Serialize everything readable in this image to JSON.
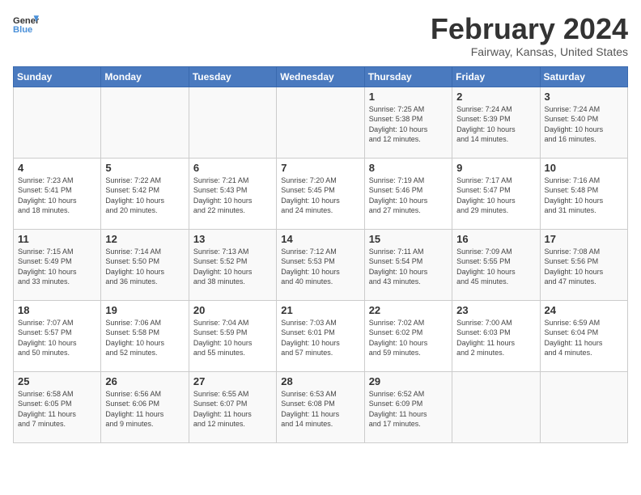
{
  "header": {
    "logo_line1": "General",
    "logo_line2": "Blue",
    "month_title": "February 2024",
    "location": "Fairway, Kansas, United States"
  },
  "days_of_week": [
    "Sunday",
    "Monday",
    "Tuesday",
    "Wednesday",
    "Thursday",
    "Friday",
    "Saturday"
  ],
  "weeks": [
    [
      {
        "num": "",
        "info": ""
      },
      {
        "num": "",
        "info": ""
      },
      {
        "num": "",
        "info": ""
      },
      {
        "num": "",
        "info": ""
      },
      {
        "num": "1",
        "info": "Sunrise: 7:25 AM\nSunset: 5:38 PM\nDaylight: 10 hours\nand 12 minutes."
      },
      {
        "num": "2",
        "info": "Sunrise: 7:24 AM\nSunset: 5:39 PM\nDaylight: 10 hours\nand 14 minutes."
      },
      {
        "num": "3",
        "info": "Sunrise: 7:24 AM\nSunset: 5:40 PM\nDaylight: 10 hours\nand 16 minutes."
      }
    ],
    [
      {
        "num": "4",
        "info": "Sunrise: 7:23 AM\nSunset: 5:41 PM\nDaylight: 10 hours\nand 18 minutes."
      },
      {
        "num": "5",
        "info": "Sunrise: 7:22 AM\nSunset: 5:42 PM\nDaylight: 10 hours\nand 20 minutes."
      },
      {
        "num": "6",
        "info": "Sunrise: 7:21 AM\nSunset: 5:43 PM\nDaylight: 10 hours\nand 22 minutes."
      },
      {
        "num": "7",
        "info": "Sunrise: 7:20 AM\nSunset: 5:45 PM\nDaylight: 10 hours\nand 24 minutes."
      },
      {
        "num": "8",
        "info": "Sunrise: 7:19 AM\nSunset: 5:46 PM\nDaylight: 10 hours\nand 27 minutes."
      },
      {
        "num": "9",
        "info": "Sunrise: 7:17 AM\nSunset: 5:47 PM\nDaylight: 10 hours\nand 29 minutes."
      },
      {
        "num": "10",
        "info": "Sunrise: 7:16 AM\nSunset: 5:48 PM\nDaylight: 10 hours\nand 31 minutes."
      }
    ],
    [
      {
        "num": "11",
        "info": "Sunrise: 7:15 AM\nSunset: 5:49 PM\nDaylight: 10 hours\nand 33 minutes."
      },
      {
        "num": "12",
        "info": "Sunrise: 7:14 AM\nSunset: 5:50 PM\nDaylight: 10 hours\nand 36 minutes."
      },
      {
        "num": "13",
        "info": "Sunrise: 7:13 AM\nSunset: 5:52 PM\nDaylight: 10 hours\nand 38 minutes."
      },
      {
        "num": "14",
        "info": "Sunrise: 7:12 AM\nSunset: 5:53 PM\nDaylight: 10 hours\nand 40 minutes."
      },
      {
        "num": "15",
        "info": "Sunrise: 7:11 AM\nSunset: 5:54 PM\nDaylight: 10 hours\nand 43 minutes."
      },
      {
        "num": "16",
        "info": "Sunrise: 7:09 AM\nSunset: 5:55 PM\nDaylight: 10 hours\nand 45 minutes."
      },
      {
        "num": "17",
        "info": "Sunrise: 7:08 AM\nSunset: 5:56 PM\nDaylight: 10 hours\nand 47 minutes."
      }
    ],
    [
      {
        "num": "18",
        "info": "Sunrise: 7:07 AM\nSunset: 5:57 PM\nDaylight: 10 hours\nand 50 minutes."
      },
      {
        "num": "19",
        "info": "Sunrise: 7:06 AM\nSunset: 5:58 PM\nDaylight: 10 hours\nand 52 minutes."
      },
      {
        "num": "20",
        "info": "Sunrise: 7:04 AM\nSunset: 5:59 PM\nDaylight: 10 hours\nand 55 minutes."
      },
      {
        "num": "21",
        "info": "Sunrise: 7:03 AM\nSunset: 6:01 PM\nDaylight: 10 hours\nand 57 minutes."
      },
      {
        "num": "22",
        "info": "Sunrise: 7:02 AM\nSunset: 6:02 PM\nDaylight: 10 hours\nand 59 minutes."
      },
      {
        "num": "23",
        "info": "Sunrise: 7:00 AM\nSunset: 6:03 PM\nDaylight: 11 hours\nand 2 minutes."
      },
      {
        "num": "24",
        "info": "Sunrise: 6:59 AM\nSunset: 6:04 PM\nDaylight: 11 hours\nand 4 minutes."
      }
    ],
    [
      {
        "num": "25",
        "info": "Sunrise: 6:58 AM\nSunset: 6:05 PM\nDaylight: 11 hours\nand 7 minutes."
      },
      {
        "num": "26",
        "info": "Sunrise: 6:56 AM\nSunset: 6:06 PM\nDaylight: 11 hours\nand 9 minutes."
      },
      {
        "num": "27",
        "info": "Sunrise: 6:55 AM\nSunset: 6:07 PM\nDaylight: 11 hours\nand 12 minutes."
      },
      {
        "num": "28",
        "info": "Sunrise: 6:53 AM\nSunset: 6:08 PM\nDaylight: 11 hours\nand 14 minutes."
      },
      {
        "num": "29",
        "info": "Sunrise: 6:52 AM\nSunset: 6:09 PM\nDaylight: 11 hours\nand 17 minutes."
      },
      {
        "num": "",
        "info": ""
      },
      {
        "num": "",
        "info": ""
      }
    ]
  ]
}
